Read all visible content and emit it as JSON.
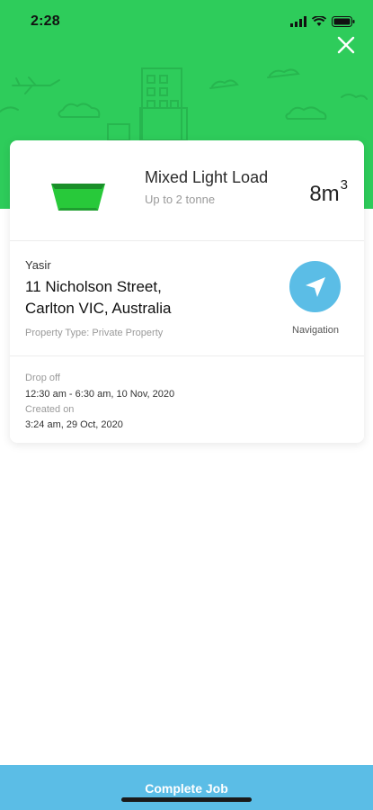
{
  "status_bar": {
    "time": "2:28"
  },
  "load": {
    "title": "Mixed Light Load",
    "subtitle": "Up to 2 tonne",
    "volume": "8m",
    "volume_exp": "3"
  },
  "job": {
    "customer": "Yasir",
    "address_line1": "11 Nicholson Street,",
    "address_line2": "Carlton VIC, Australia",
    "property_type": "Property Type: Private Property",
    "navigation_label": "Navigation"
  },
  "schedule": {
    "dropoff_label": "Drop off",
    "dropoff_value": "12:30 am - 6:30 am, 10 Nov, 2020",
    "created_label": "Created on",
    "created_value": "3:24 am, 29 Oct, 2020"
  },
  "footer": {
    "action_label": "Complete Job"
  },
  "colors": {
    "hero": "#2ecc5b",
    "accent": "#5bbde6",
    "bin": "#28c93a"
  },
  "icons": {
    "close": "close-icon",
    "navigation": "navigation-arrow-icon",
    "bin": "skip-bin-icon"
  }
}
